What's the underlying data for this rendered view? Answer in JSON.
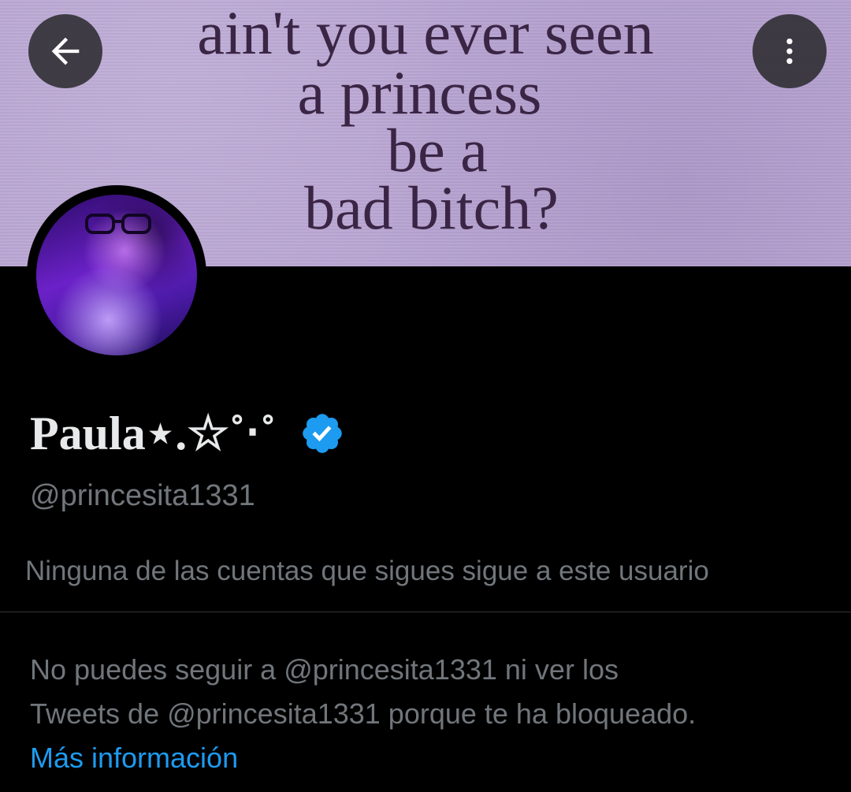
{
  "banner": {
    "lines": [
      "ain't you ever seen",
      "a princess",
      "be a",
      "bad bitch?"
    ]
  },
  "header": {
    "back_icon": "arrow-left-icon",
    "more_icon": "more-vertical-icon"
  },
  "profile": {
    "display_name": "Paula⋆.☆˚‧˚",
    "verified_icon": "verified-badge-icon",
    "verified_color": "#1d9bf0",
    "handle": "@princesita1331",
    "followed_by_note": "Ninguna de las cuentas que sigues sigue a este usuario"
  },
  "blocked_notice": {
    "line1": "No puedes seguir a @princesita1331 ni ver los",
    "line2": "Tweets de @princesita1331 porque te ha bloqueado.",
    "learn_more_label": "Más información",
    "link_color": "#1d9bf0"
  }
}
